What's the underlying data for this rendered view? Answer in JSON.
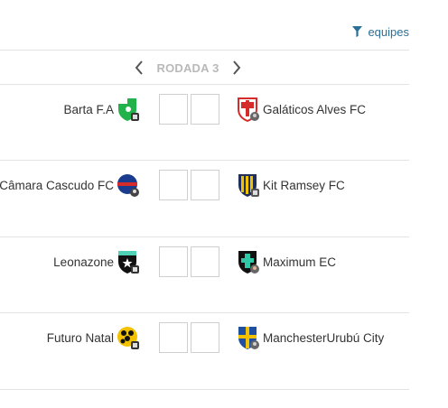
{
  "header": {
    "filter_label": "equipes",
    "round_label": "RODADA 3"
  },
  "matches": [
    {
      "home": {
        "name": "Barta F.A"
      },
      "away": {
        "name": "Galáticos Alves FC"
      }
    },
    {
      "home": {
        "name": "Câmara Cascudo FC"
      },
      "away": {
        "name": "Kit Ramsey FC"
      }
    },
    {
      "home": {
        "name": "Leonazone"
      },
      "away": {
        "name": "Maximum EC"
      }
    },
    {
      "home": {
        "name": "Futuro Natal"
      },
      "away": {
        "name": "ManchesterUrubú City"
      }
    }
  ],
  "colors": {
    "link": "#2a6f97",
    "round_label": "#b9b9b9",
    "divider": "#e3e3e3"
  },
  "icons": {
    "filter": "funnel-icon",
    "prev": "chevron-left-icon",
    "next": "chevron-right-icon"
  }
}
